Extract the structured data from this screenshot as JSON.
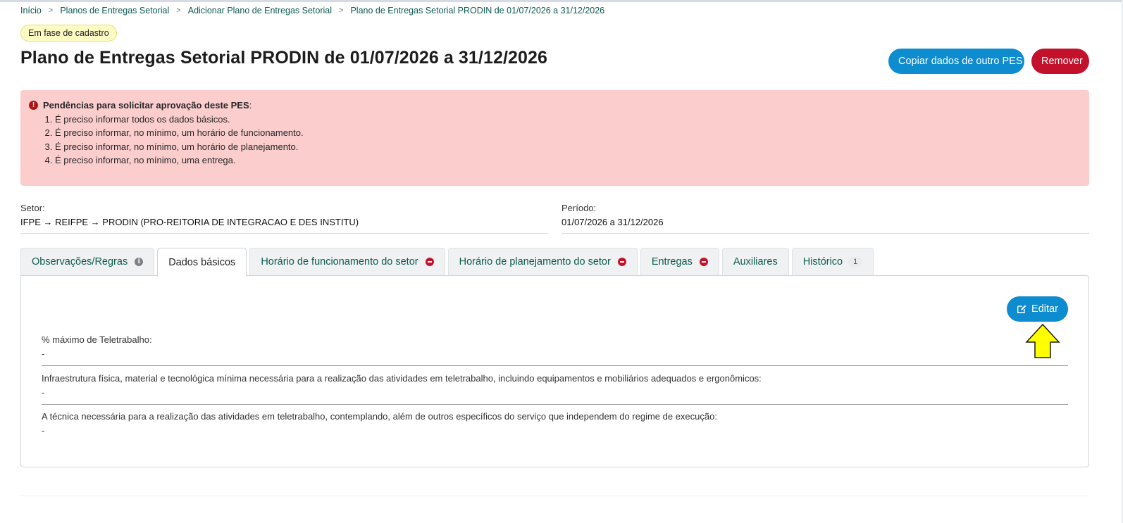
{
  "breadcrumb": {
    "items": [
      "Início",
      "Planos de Entregas Setorial",
      "Adicionar Plano de Entregas Setorial"
    ],
    "current": "Plano de Entregas Setorial PRODIN de 01/07/2026 a 31/12/2026",
    "separator": ">"
  },
  "status_badge": "Em fase de cadastro",
  "page_title": "Plano de Entregas Setorial PRODIN de 01/07/2026 a 31/12/2026",
  "header_actions": {
    "copy_label": "Copiar dados de outro PES",
    "remove_label": "Remover"
  },
  "alert": {
    "icon": "exclamation-circle-icon",
    "heading": "Pendências para solicitar aprovação deste PES",
    "heading_suffix": ":",
    "items": [
      "É preciso informar todos os dados básicos.",
      "É preciso informar, no mínimo, um horário de funcionamento.",
      "É preciso informar, no mínimo, um horário de planejamento.",
      "É preciso informar, no mínimo, uma entrega."
    ]
  },
  "fields": {
    "setor": {
      "label": "Setor:",
      "value": "IFPE → REIFPE → PRODIN (PRO-REITORIA DE INTEGRACAO E DES INSTITU)"
    },
    "periodo": {
      "label": "Período:",
      "value": "01/07/2026 a 31/12/2026"
    }
  },
  "tabs": [
    {
      "label": "Observações/Regras",
      "icon": "info-icon"
    },
    {
      "label": "Dados básicos",
      "active": true
    },
    {
      "label": "Horário de funcionamento do setor",
      "icon": "minus-circle-icon"
    },
    {
      "label": "Horário de planejamento do setor",
      "icon": "minus-circle-icon"
    },
    {
      "label": "Entregas",
      "icon": "minus-circle-icon"
    },
    {
      "label": "Auxiliares"
    },
    {
      "label": "Histórico",
      "count": "1"
    }
  ],
  "edit_button": {
    "label": "Editar",
    "icon": "edit-icon"
  },
  "details": [
    {
      "label": "% máximo de Teletrabalho:",
      "value": "-"
    },
    {
      "label": "Infraestrutura física, material e tecnológica mínima necessária para a realização das atividades em teletrabalho, incluindo equipamentos e mobiliários adequados e ergonômicos:",
      "value": "-"
    },
    {
      "label": "A técnica necessária para a realização das atividades em teletrabalho, contemplando, além de outros específicos do serviço que independem do regime de execução:",
      "value": "-"
    }
  ],
  "annotation": {
    "icon": "yellow-arrow-up-icon",
    "color": "#ffff00"
  },
  "colors": {
    "primary": "#0d8ccf",
    "danger": "#c3112b",
    "alert_bg": "#fbcdcd",
    "link": "#0b5b4e"
  }
}
